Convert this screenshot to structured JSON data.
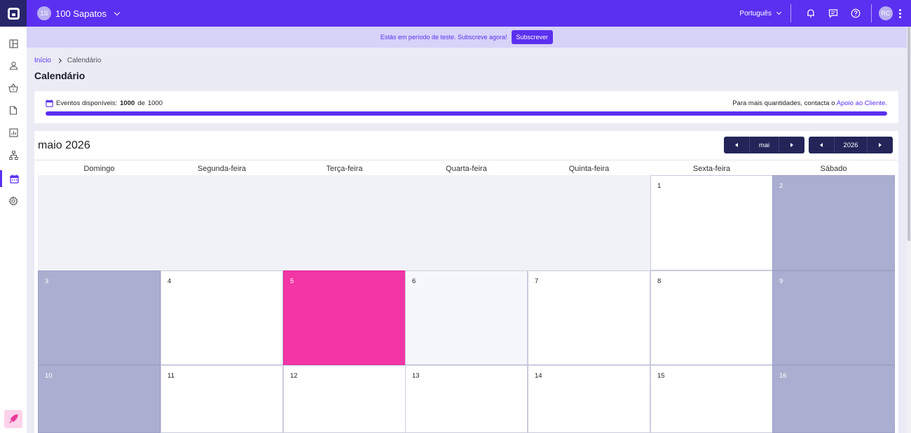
{
  "topbar": {
    "store_initials": "1S",
    "store_name": "100 Sapatos",
    "language": "Português",
    "user_initials": "RC"
  },
  "banner": {
    "text": "Estás em período de teste. Subscreve agora!",
    "button_label": "Subscrever"
  },
  "sidebar": {
    "items": [
      {
        "icon": "dashboard-icon"
      },
      {
        "icon": "user-icon"
      },
      {
        "icon": "basket-icon"
      },
      {
        "icon": "document-icon"
      },
      {
        "icon": "chart-icon"
      },
      {
        "icon": "hierarchy-icon"
      },
      {
        "icon": "calendar-icon",
        "active": true
      },
      {
        "icon": "gear-icon"
      }
    ],
    "bottom_icon": "rocket-icon"
  },
  "breadcrumb": {
    "home": "Início",
    "current": "Calendário"
  },
  "page_title": "Calendário",
  "events": {
    "label": "Eventos disponíveis:",
    "used": "1000",
    "of": "de",
    "total": "1000",
    "fill_fraction": 1.0,
    "contact_text": "Para mais quantidades, contacta o",
    "contact_link": "Apoio ao Cliente."
  },
  "calendar": {
    "title": "maio 2026",
    "month_nav": "mai",
    "year_nav": "2026",
    "weekdays": [
      "Domingo",
      "Segunda-feira",
      "Terça-feira",
      "Quarta-feira",
      "Quinta-feira",
      "Sexta-feira",
      "Sábado"
    ],
    "weeks": [
      [
        "",
        "",
        "",
        "",
        "",
        "1",
        "2"
      ],
      [
        "3",
        "4",
        "5",
        "6",
        "7",
        "8",
        "9"
      ],
      [
        "10",
        "11",
        "12",
        "13",
        "14",
        "15",
        "16"
      ]
    ],
    "today": "5",
    "colors": {
      "weekend": "#aaaed0",
      "today": "#f236a5",
      "nav": "#232559",
      "accent": "#5b30f0"
    }
  }
}
